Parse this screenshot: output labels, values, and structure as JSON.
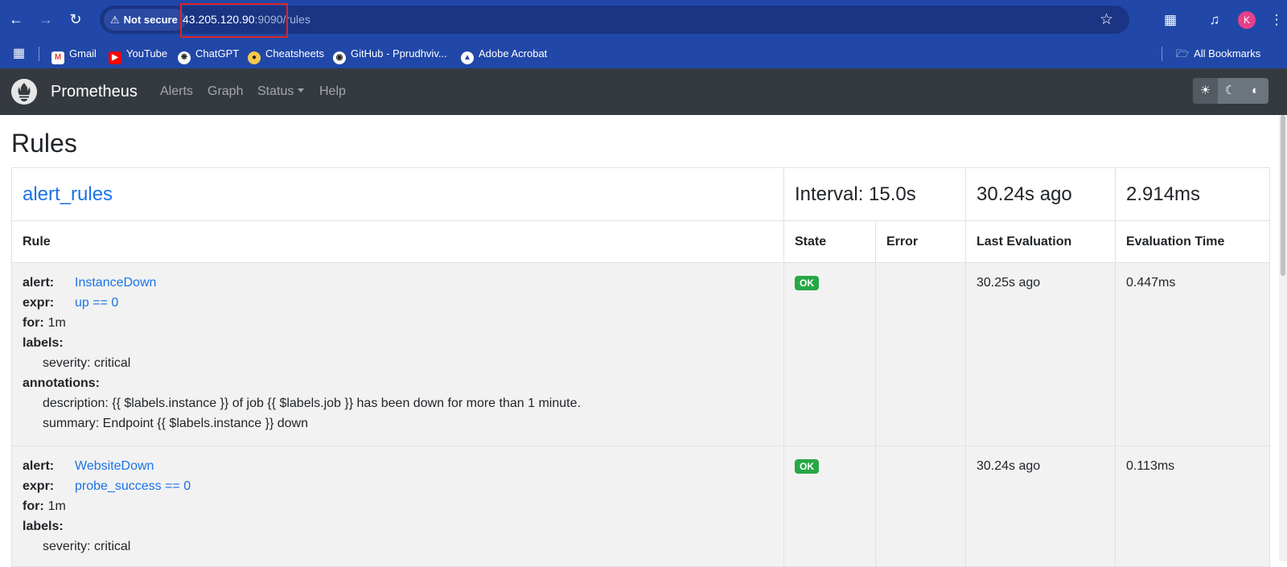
{
  "browser": {
    "security_label": "Not secure",
    "url_host": "43.205.120.90",
    "url_port": ":9090",
    "url_path": "/rules",
    "avatar_letter": "K",
    "bookmarks": [
      {
        "label": "Gmail",
        "icon": "gmail-icon",
        "color": "#ea4335"
      },
      {
        "label": "YouTube",
        "icon": "youtube-icon",
        "color": "#ff0000"
      },
      {
        "label": "ChatGPT",
        "icon": "chatgpt-icon",
        "color": "#ffffff"
      },
      {
        "label": "Cheatsheets",
        "icon": "cheatsheets-icon",
        "color": "#f2c94c"
      },
      {
        "label": "GitHub - Pprudhviv...",
        "icon": "github-icon",
        "color": "#ffffff"
      },
      {
        "label": "Adobe Acrobat",
        "icon": "acrobat-icon",
        "color": "#ffffff"
      }
    ],
    "all_bookmarks": "All Bookmarks"
  },
  "navbar": {
    "brand": "Prometheus",
    "links": [
      "Alerts",
      "Graph",
      "Status",
      "Help"
    ]
  },
  "page": {
    "title": "Rules"
  },
  "group": {
    "name": "alert_rules",
    "interval": "Interval: 15.0s",
    "last_eval": "30.24s ago",
    "eval_time": "2.914ms"
  },
  "columns": {
    "rule": "Rule",
    "state": "State",
    "error": "Error",
    "last_eval": "Last Evaluation",
    "eval_time": "Evaluation Time"
  },
  "rules": [
    {
      "alert_key": "alert:",
      "alert": "InstanceDown",
      "expr_key": "expr:",
      "expr": "up == 0",
      "for_key": "for:",
      "for": "1m",
      "labels_key": "labels:",
      "label_severity": "severity: critical",
      "annotations_key": "annotations:",
      "description": "description: {{ $labels.instance }} of job {{ $labels.job }} has been down for more than 1 minute.",
      "summary": "summary: Endpoint {{ $labels.instance }} down",
      "state": "OK",
      "error": "",
      "last_eval": "30.25s ago",
      "eval_time": "0.447ms"
    },
    {
      "alert_key": "alert:",
      "alert": "WebsiteDown",
      "expr_key": "expr:",
      "expr": "probe_success == 0",
      "for_key": "for:",
      "for": "1m",
      "labels_key": "labels:",
      "label_severity": "severity: critical",
      "state": "OK",
      "error": "",
      "last_eval": "30.24s ago",
      "eval_time": "0.113ms"
    }
  ],
  "colors": {
    "chrome": "#2148a8",
    "navbar": "#343a40",
    "link": "#1a73e8",
    "ok_badge": "#28a745",
    "highlight": "#e02424"
  }
}
